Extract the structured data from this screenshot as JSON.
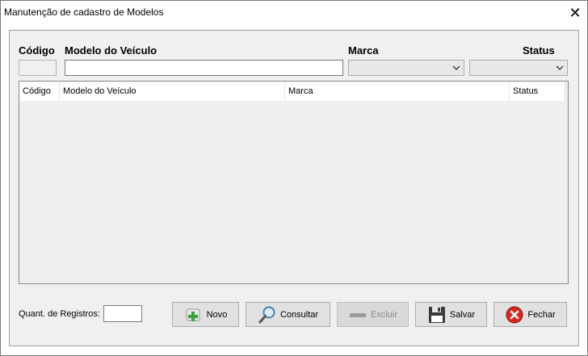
{
  "window": {
    "title": "Manutenção de cadastro de Modelos",
    "close_glyph": "✕"
  },
  "filters": {
    "codigo_label": "Código",
    "modelo_label": "Modelo do Veículo",
    "marca_label": "Marca",
    "status_label": "Status",
    "codigo_value": "",
    "modelo_value": "",
    "marca_value": "",
    "status_value": ""
  },
  "grid": {
    "columns": [
      "Código",
      "Modelo do Veículo",
      "Marca",
      "Status"
    ],
    "rows": []
  },
  "footer": {
    "count_label": "Quant. de Registros:",
    "count_value": ""
  },
  "buttons": {
    "novo": "Novo",
    "consultar": "Consultar",
    "excluir": "Excluir",
    "salvar": "Salvar",
    "fechar": "Fechar"
  },
  "icons": {
    "novo": "plus-icon",
    "consultar": "magnifier-icon",
    "excluir": "minus-icon",
    "salvar": "floppy-disk-icon",
    "fechar": "close-circle-icon"
  },
  "colors": {
    "plus_green": "#3aa33a",
    "close_red": "#d9261c",
    "floppy_dark": "#3a3a3a",
    "magnifier_blue": "#4a7fb5"
  }
}
